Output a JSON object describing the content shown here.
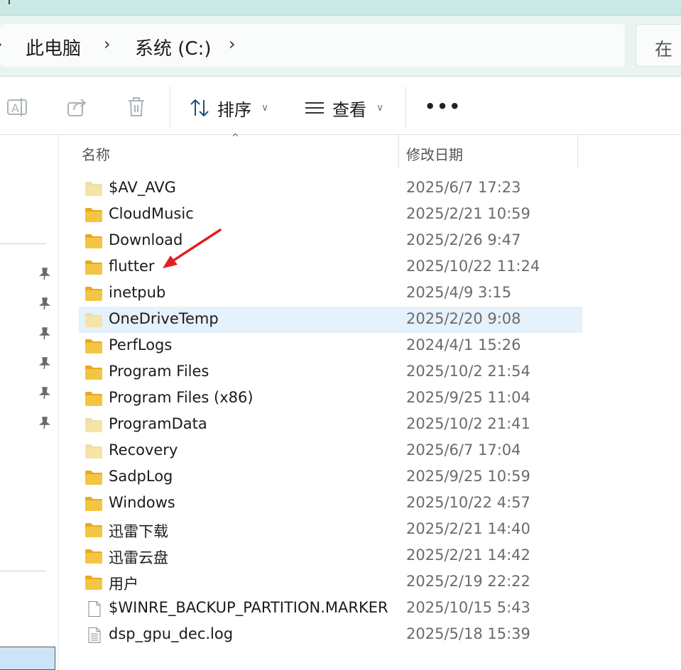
{
  "address": {
    "crumbs": [
      "此电脑",
      "系统 (C:)"
    ],
    "search_placeholder": "在 "
  },
  "toolbar": {
    "sort_label": "排序",
    "view_label": "查看",
    "more_label": "•••"
  },
  "columns": {
    "name": "名称",
    "date_modified": "修改日期"
  },
  "files": [
    {
      "name": "$AV_AVG",
      "date": "2025/6/7 17:23",
      "icon": "folder-faded-icon"
    },
    {
      "name": "CloudMusic",
      "date": "2025/2/21 10:59",
      "icon": "folder-icon"
    },
    {
      "name": "Download",
      "date": "2025/2/26 9:47",
      "icon": "folder-icon"
    },
    {
      "name": "flutter",
      "date": "2025/10/22 11:24",
      "icon": "folder-icon"
    },
    {
      "name": "inetpub",
      "date": "2025/4/9 3:15",
      "icon": "folder-icon"
    },
    {
      "name": "OneDriveTemp",
      "date": "2025/2/20 9:08",
      "icon": "folder-faded-icon",
      "selected": true
    },
    {
      "name": "PerfLogs",
      "date": "2024/4/1 15:26",
      "icon": "folder-icon"
    },
    {
      "name": "Program Files",
      "date": "2025/10/2 21:54",
      "icon": "folder-icon"
    },
    {
      "name": "Program Files (x86)",
      "date": "2025/9/25 11:04",
      "icon": "folder-icon"
    },
    {
      "name": "ProgramData",
      "date": "2025/10/2 21:41",
      "icon": "folder-faded-icon"
    },
    {
      "name": "Recovery",
      "date": "2025/6/7 17:04",
      "icon": "folder-faded-icon"
    },
    {
      "name": "SadpLog",
      "date": "2025/9/25 10:59",
      "icon": "folder-icon"
    },
    {
      "name": "Windows",
      "date": "2025/10/22 4:57",
      "icon": "folder-icon"
    },
    {
      "name": "迅雷下载",
      "date": "2025/2/21 14:40",
      "icon": "folder-icon"
    },
    {
      "name": "迅雷云盘",
      "date": "2025/2/21 14:42",
      "icon": "folder-icon"
    },
    {
      "name": "用户",
      "date": "2025/2/19 22:22",
      "icon": "folder-icon"
    },
    {
      "name": "$WINRE_BACKUP_PARTITION.MARKER",
      "date": "2025/10/15 5:43",
      "icon": "file-icon"
    },
    {
      "name": "dsp_gpu_dec.log",
      "date": "2025/5/18 15:39",
      "icon": "text-file-icon"
    }
  ],
  "colors": {
    "folder": "#f4c542",
    "folder_faded": "#f6e3a6",
    "selection": "#e5f1fb",
    "annotation_arrow": "#e02020"
  }
}
